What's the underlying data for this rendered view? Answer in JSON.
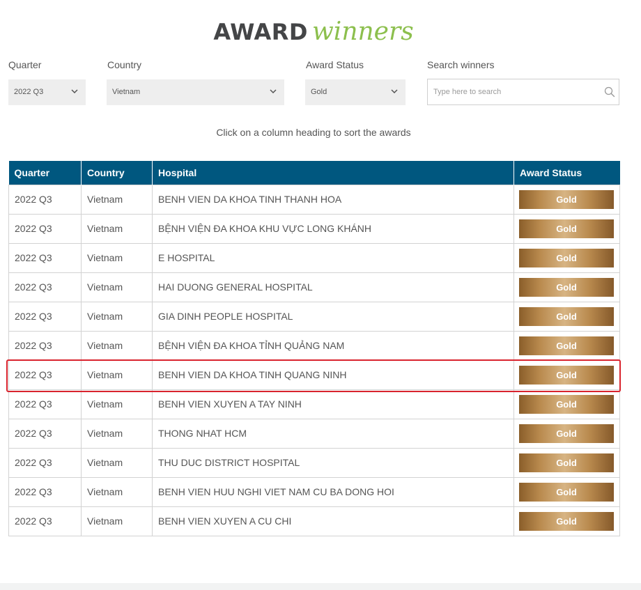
{
  "page": {
    "title_bold": "AWARD",
    "title_script": "winners",
    "hint": "Click on a column heading to sort the awards"
  },
  "filters": {
    "quarter": {
      "label": "Quarter",
      "value": "2022 Q3"
    },
    "country": {
      "label": "Country",
      "value": "Vietnam"
    },
    "status": {
      "label": "Award Status",
      "value": "Gold"
    },
    "search": {
      "label": "Search winners",
      "placeholder": "Type here to search",
      "value": ""
    }
  },
  "table": {
    "headers": [
      "Quarter",
      "Country",
      "Hospital",
      "Award Status"
    ],
    "rows": [
      {
        "quarter": "2022 Q3",
        "country": "Vietnam",
        "hospital": "BENH VIEN DA KHOA TINH THANH HOA",
        "status": "Gold"
      },
      {
        "quarter": "2022 Q3",
        "country": "Vietnam",
        "hospital": "BỆNH VIỆN ĐA KHOA KHU VỰC LONG KHÁNH",
        "status": "Gold"
      },
      {
        "quarter": "2022 Q3",
        "country": "Vietnam",
        "hospital": "E HOSPITAL",
        "status": "Gold"
      },
      {
        "quarter": "2022 Q3",
        "country": "Vietnam",
        "hospital": "HAI DUONG GENERAL HOSPITAL",
        "status": "Gold"
      },
      {
        "quarter": "2022 Q3",
        "country": "Vietnam",
        "hospital": "GIA DINH PEOPLE HOSPITAL",
        "status": "Gold"
      },
      {
        "quarter": "2022 Q3",
        "country": "Vietnam",
        "hospital": "BỆNH VIỆN ĐA KHOA TỈNH QUẢNG NAM",
        "status": "Gold"
      },
      {
        "quarter": "2022 Q3",
        "country": "Vietnam",
        "hospital": "BENH VIEN DA KHOA TINH QUANG NINH",
        "status": "Gold"
      },
      {
        "quarter": "2022 Q3",
        "country": "Vietnam",
        "hospital": "BENH VIEN XUYEN A TAY NINH",
        "status": "Gold"
      },
      {
        "quarter": "2022 Q3",
        "country": "Vietnam",
        "hospital": "THONG NHAT HCM",
        "status": "Gold"
      },
      {
        "quarter": "2022 Q3",
        "country": "Vietnam",
        "hospital": "THU DUC DISTRICT HOSPITAL",
        "status": "Gold"
      },
      {
        "quarter": "2022 Q3",
        "country": "Vietnam",
        "hospital": "BENH VIEN HUU NGHI VIET NAM CU BA DONG HOI",
        "status": "Gold"
      },
      {
        "quarter": "2022 Q3",
        "country": "Vietnam",
        "hospital": "BENH VIEN XUYEN A CU CHI",
        "status": "Gold"
      }
    ]
  },
  "colors": {
    "header_bg": "#00577f",
    "title_accent": "#8cbf4d",
    "highlight": "#d9232d"
  }
}
